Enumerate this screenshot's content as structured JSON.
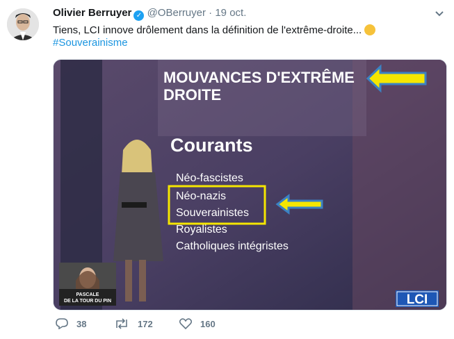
{
  "tweet": {
    "author": "Olivier Berruyer",
    "handle": "@OBerruyer",
    "separator": "·",
    "date": "19 oct.",
    "text": "Tiens, LCI innove drôlement dans la définition de l'extrême-droite...",
    "hashtag": "#Souverainisme"
  },
  "media": {
    "headline_line1": "MOUVANCES D'EXTRÊME",
    "headline_line2": "DROITE",
    "section_title": "Courants",
    "currents": [
      "Néo-fascistes",
      "Néo-nazis",
      "Souverainistes",
      "Royalistes",
      "Catholiques intégristes"
    ],
    "inset_caption_line1": "PASCALE",
    "inset_caption_line2": "DE LA TOUR DU PIN",
    "logo": "LCI",
    "highlight_color": "#f5e600",
    "arrow_color": "#3b82c4"
  },
  "actions": {
    "replies": "38",
    "retweets": "172",
    "likes": "160"
  }
}
